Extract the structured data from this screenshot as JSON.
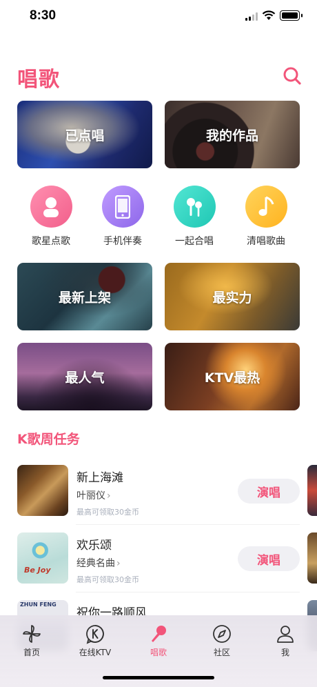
{
  "status_bar": {
    "time": "8:30"
  },
  "header": {
    "title": "唱歌"
  },
  "feature_cards": [
    {
      "label": "已点唱"
    },
    {
      "label": "我的作品"
    },
    {
      "label": "最新上架"
    },
    {
      "label": "最实力"
    },
    {
      "label": "最人气"
    },
    {
      "label": "KTV最热"
    }
  ],
  "categories": [
    {
      "label": "歌星点歌",
      "icon": "singer-icon"
    },
    {
      "label": "手机伴奏",
      "icon": "phone-icon"
    },
    {
      "label": "一起合唱",
      "icon": "duet-mic-icon"
    },
    {
      "label": "清唱歌曲",
      "icon": "music-note-icon"
    }
  ],
  "weekly_tasks": {
    "title": "K歌周任务",
    "items": [
      {
        "song": "新上海滩",
        "artist": "叶丽仪",
        "reward": "最高可领取30金币",
        "action": "演唱"
      },
      {
        "song": "欢乐颂",
        "artist": "经典名曲",
        "reward": "最高可领取30金币",
        "action": "演唱",
        "thumb_text": "Be Joy"
      },
      {
        "song": "祝你一路顺风",
        "thumb_text": "ZHUN FENG"
      }
    ]
  },
  "tabbar": {
    "items": [
      {
        "label": "首页",
        "icon": "pinwheel-icon"
      },
      {
        "label": "在线KTV",
        "icon": "ktv-icon"
      },
      {
        "label": "唱歌",
        "icon": "microphone-icon",
        "active": true
      },
      {
        "label": "社区",
        "icon": "compass-icon"
      },
      {
        "label": "我",
        "icon": "person-icon"
      }
    ]
  },
  "colors": {
    "accent": "#f2557a",
    "button_bg": "#f0f0f4"
  }
}
